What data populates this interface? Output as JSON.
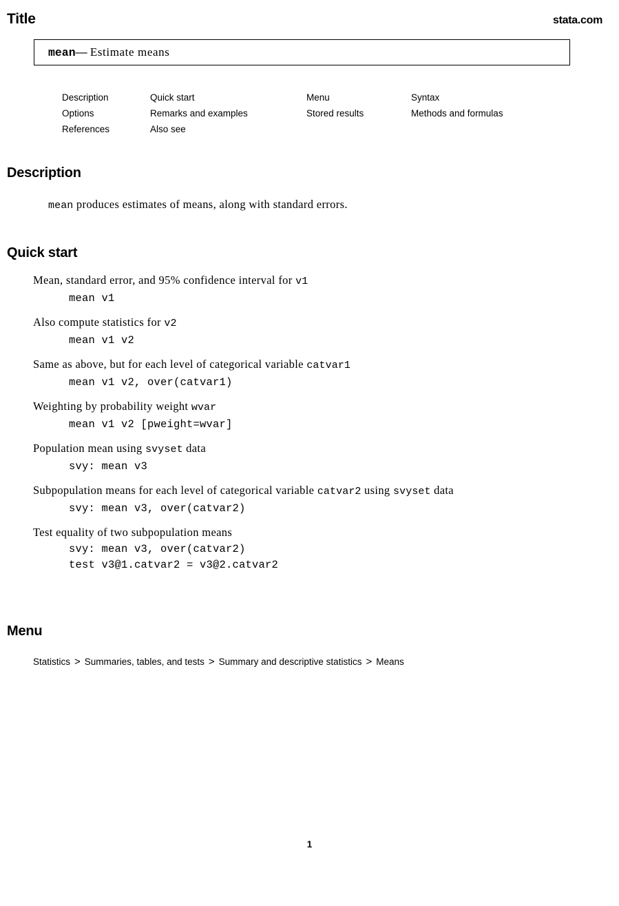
{
  "header": {
    "title": "Title",
    "site_link": "stata.com"
  },
  "title_box": {
    "command": "mean",
    "dash": "—",
    "description": "Estimate means"
  },
  "nav_links": {
    "rows": [
      [
        "Description",
        "Quick start",
        "Menu",
        "Syntax"
      ],
      [
        "Options",
        "Remarks and examples",
        "Stored results",
        "Methods and formulas"
      ],
      [
        "References",
        "Also see",
        "",
        ""
      ]
    ]
  },
  "sections": {
    "description": {
      "heading": "Description",
      "body_command": "mean",
      "body_text": " produces estimates of means, along with standard errors."
    },
    "quick_start": {
      "heading": "Quick start",
      "items": [
        {
          "desc_pre": "Mean, standard error, and 95% confidence interval for ",
          "desc_mono": "v1",
          "desc_post": "",
          "commands": [
            "mean v1"
          ]
        },
        {
          "desc_pre": "Also compute statistics for ",
          "desc_mono": "v2",
          "desc_post": "",
          "commands": [
            "mean v1 v2"
          ]
        },
        {
          "desc_pre": "Same as above, but for each level of categorical variable ",
          "desc_mono": "catvar1",
          "desc_post": "",
          "commands": [
            "mean v1 v2, over(catvar1)"
          ]
        },
        {
          "desc_pre": "Weighting by probability weight ",
          "desc_mono": "wvar",
          "desc_post": "",
          "commands": [
            "mean v1 v2 [pweight=wvar]"
          ]
        },
        {
          "desc_pre": "Population mean using ",
          "desc_mono": "svyset",
          "desc_post": " data",
          "commands": [
            "svy: mean v3"
          ]
        },
        {
          "desc_pre": "Subpopulation means for each level of categorical variable ",
          "desc_mono": "catvar2",
          "desc_mono2": "svyset",
          "desc_mid": " using ",
          "desc_post": " data",
          "commands": [
            "svy: mean v3, over(catvar2)"
          ]
        },
        {
          "desc_pre": "Test equality of two subpopulation means",
          "desc_mono": "",
          "desc_post": "",
          "commands": [
            "svy: mean v3, over(catvar2)",
            "test v3@1.catvar2 = v3@2.catvar2"
          ]
        }
      ]
    },
    "menu": {
      "heading": "Menu",
      "path": [
        "Statistics",
        "Summaries, tables, and tests",
        "Summary and descriptive statistics",
        "Means"
      ],
      "separator": ">"
    }
  },
  "footer": {
    "page_number": "1"
  }
}
